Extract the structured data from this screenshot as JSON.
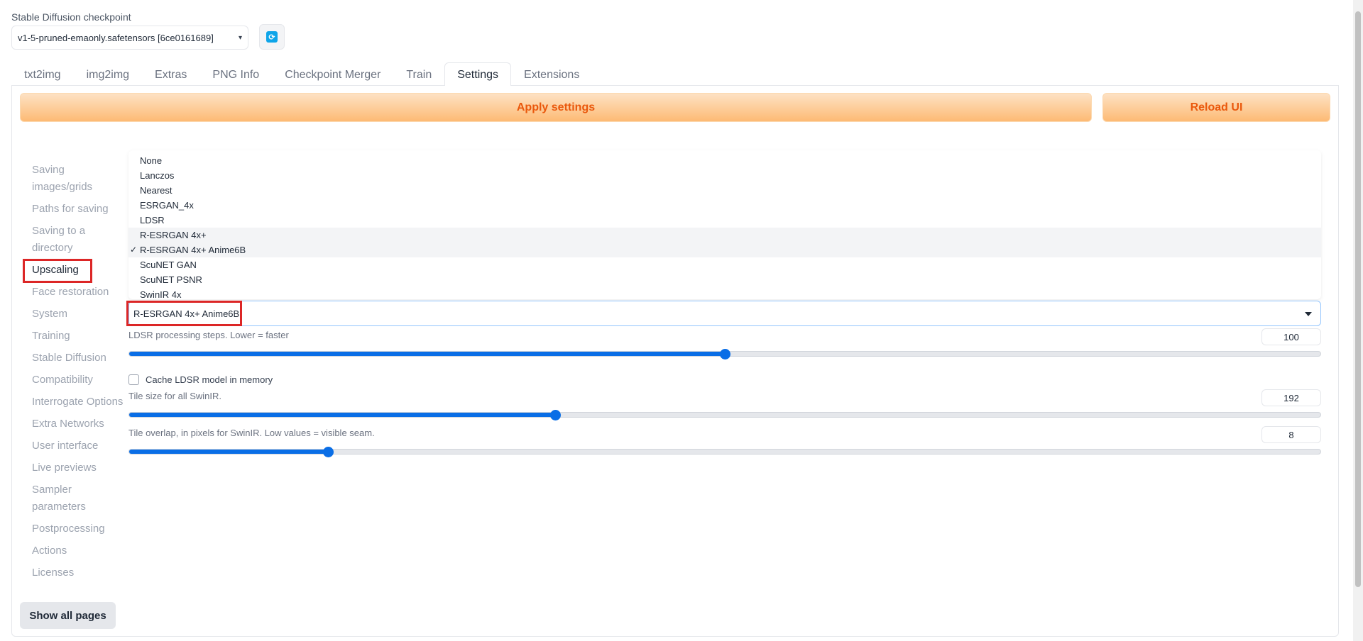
{
  "checkpoint": {
    "label": "Stable Diffusion checkpoint",
    "value": "v1-5-pruned-emaonly.safetensors [6ce0161689]"
  },
  "tabs": [
    {
      "label": "txt2img"
    },
    {
      "label": "img2img"
    },
    {
      "label": "Extras"
    },
    {
      "label": "PNG Info"
    },
    {
      "label": "Checkpoint Merger"
    },
    {
      "label": "Train"
    },
    {
      "label": "Settings",
      "active": true
    },
    {
      "label": "Extensions"
    }
  ],
  "buttons": {
    "apply": "Apply settings",
    "reload": "Reload UI",
    "show_all": "Show all pages"
  },
  "sidebar": {
    "items": [
      {
        "label": "Saving images/grids"
      },
      {
        "label": "Paths for saving"
      },
      {
        "label": "Saving to a directory"
      },
      {
        "label": "Upscaling",
        "selected": true
      },
      {
        "label": "Face restoration"
      },
      {
        "label": "System"
      },
      {
        "label": "Training"
      },
      {
        "label": "Stable Diffusion"
      },
      {
        "label": "Compatibility"
      },
      {
        "label": "Interrogate Options"
      },
      {
        "label": "Extra Networks"
      },
      {
        "label": "User interface"
      },
      {
        "label": "Live previews"
      },
      {
        "label": "Sampler parameters"
      },
      {
        "label": "Postprocessing"
      },
      {
        "label": "Actions"
      },
      {
        "label": "Licenses"
      }
    ]
  },
  "upscaler_dropdown": {
    "selected": "R-ESRGAN 4x+ Anime6B",
    "options": [
      "None",
      "Lanczos",
      "Nearest",
      "ESRGAN_4x",
      "LDSR",
      "R-ESRGAN 4x+",
      "R-ESRGAN 4x+ Anime6B",
      "ScuNET GAN",
      "ScuNET PSNR",
      "SwinIR 4x"
    ],
    "check_mark": "✓"
  },
  "settings": {
    "ldsr_steps": {
      "label": "LDSR processing steps. Lower = faster",
      "value": "100",
      "fraction": 0.5
    },
    "cache_ldsr": {
      "label": "Cache LDSR model in memory",
      "checked": false
    },
    "swinir_tile": {
      "label": "Tile size for all SwinIR.",
      "value": "192",
      "fraction": 0.358
    },
    "swinir_overlap": {
      "label": "Tile overlap, in pixels for SwinIR. Low values = visible seam.",
      "value": "8",
      "fraction": 0.167
    }
  },
  "colors": {
    "accent": "#0a6ee6",
    "highlight": "#dc2626",
    "button_text": "#ea580c"
  }
}
